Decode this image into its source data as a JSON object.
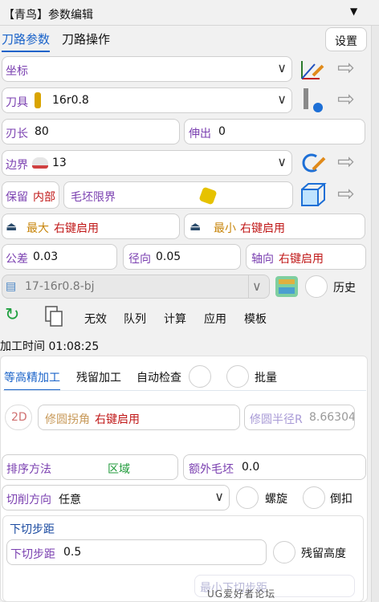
{
  "window": {
    "title": "【青鸟】参数编辑",
    "collapse": "▼"
  },
  "tabs": [
    {
      "label": "刀路参数"
    },
    {
      "label": "刀路操作"
    }
  ],
  "settings_label": "设置",
  "coord": {
    "label": "坐标"
  },
  "tool": {
    "label": "刀具",
    "value": "16r0.8"
  },
  "blade": {
    "label": "刃长",
    "value": "80"
  },
  "extend": {
    "label": "伸出",
    "value": "0"
  },
  "boundary": {
    "label": "边界",
    "value": "13"
  },
  "keep": {
    "label": "保留",
    "value": "内部"
  },
  "stock_limit": {
    "label": "毛坯限界"
  },
  "max": {
    "label": "最大",
    "value": "右键启用"
  },
  "min": {
    "label": "最小",
    "value": "右键启用"
  },
  "tolerance": {
    "label": "公差",
    "value": "0.03"
  },
  "radial": {
    "label": "径向",
    "value": "0.05"
  },
  "axial": {
    "label": "轴向",
    "value": "右键启用"
  },
  "history_select": {
    "value": "17-16r0.8-bj"
  },
  "history_label": "历史",
  "toolbar": {
    "invalid": "无效",
    "queue": "队列",
    "compute": "计算",
    "apply": "应用",
    "template": "模板"
  },
  "machining_time": "加工时间 01:08:25",
  "subtabs": {
    "finish": "等高精加工",
    "residual": "残留加工",
    "auto_check": "自动检查",
    "batch": "批量"
  },
  "fillet": {
    "badge": "2D",
    "label": "修圆拐角",
    "value": "右键启用",
    "radius_label": "修圆半径R",
    "radius_value": "8.66304"
  },
  "sort": {
    "label": "排序方法",
    "value": "区域"
  },
  "extra_stock": {
    "label": "额外毛坯",
    "value": "0.0"
  },
  "cut_dir": {
    "label": "切削方向",
    "value": "任意"
  },
  "spiral": "螺旋",
  "chamfer": "倒扣",
  "stepdown": {
    "title": "下切步距",
    "label": "下切步距",
    "value": "0.5",
    "residual_height": "残留高度",
    "min_label": "最小下切步距"
  },
  "watermark": "UG爱好者论坛 WWW.UGSNX.COM"
}
